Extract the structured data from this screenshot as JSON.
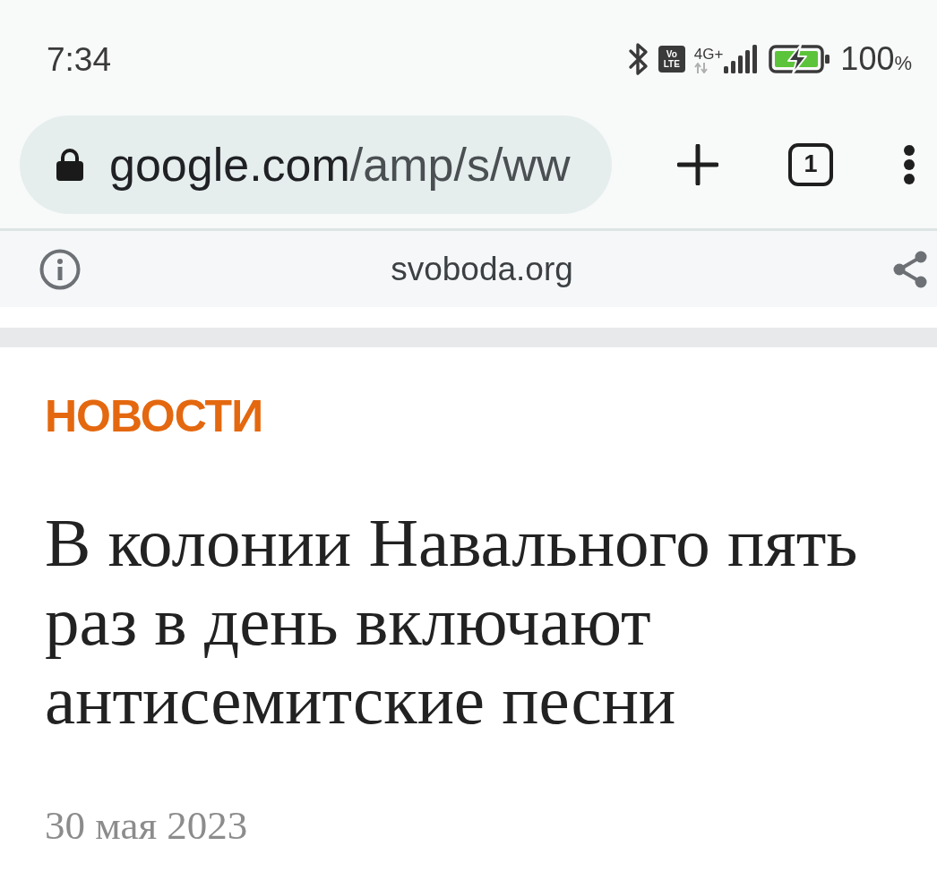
{
  "status_bar": {
    "time": "7:34",
    "volte_badge": [
      "Vo",
      "LTE"
    ],
    "network_type": "4G+",
    "battery": {
      "charging": true,
      "percent": "100",
      "unit": "%"
    }
  },
  "toolbar": {
    "url": {
      "domain": "google.com",
      "path": "/amp/s/ww"
    },
    "tab_count": "1"
  },
  "info_bar": {
    "site": "svoboda.org"
  },
  "article": {
    "category": "НОВОСТИ",
    "headline": "В колонии Навального пять раз в день включают антисемитские песни",
    "date": "30 мая 2023"
  }
}
